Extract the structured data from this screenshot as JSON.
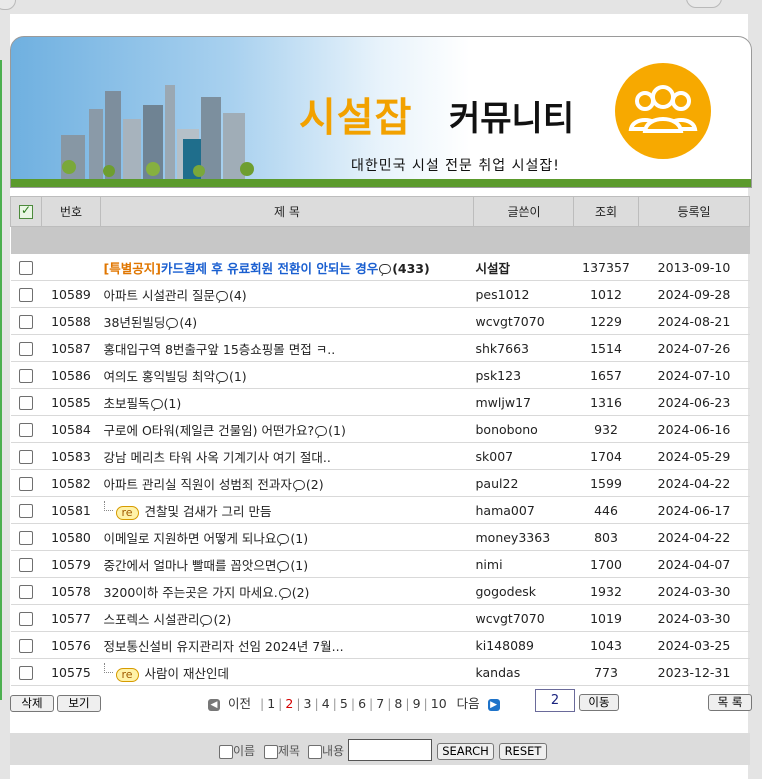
{
  "banner": {
    "title_orange": "시설잡",
    "title_dark": "커뮤니티",
    "subtitle": "대한민국 시설 전문 취업 시설잡!"
  },
  "table": {
    "headers": {
      "num": "번호",
      "subject": "제 목",
      "writer": "글쓴이",
      "views": "조회",
      "date": "등록일"
    },
    "notice": {
      "tag": "[특별공지]",
      "title": "카드결제 후 유료회원 전환이 안되는 경우",
      "comments": "(433)",
      "writer": "시설잡",
      "views": "137357",
      "date": "2013-09-10"
    },
    "rows": [
      {
        "num": "10589",
        "title": "아파트 시설관리 질문",
        "comments": "(4)",
        "writer": "pes1012",
        "views": "1012",
        "date": "2024-09-28",
        "reply": false
      },
      {
        "num": "10588",
        "title": "38년된빌딩",
        "comments": "(4)",
        "writer": "wcvgt7070",
        "views": "1229",
        "date": "2024-08-21",
        "reply": false
      },
      {
        "num": "10587",
        "title": "홍대입구역 8번출구앞 15층쇼핑몰 면접 ㅋ..",
        "comments": "",
        "writer": "shk7663",
        "views": "1514",
        "date": "2024-07-26",
        "reply": false
      },
      {
        "num": "10586",
        "title": "여의도 홍익빌딩 최악",
        "comments": "(1)",
        "writer": "psk123",
        "views": "1657",
        "date": "2024-07-10",
        "reply": false
      },
      {
        "num": "10585",
        "title": "초보필독",
        "comments": "(1)",
        "writer": "mwljw17",
        "views": "1316",
        "date": "2024-06-23",
        "reply": false
      },
      {
        "num": "10584",
        "title": "구로에 O타워(제일큰 건물임) 어떤가요?",
        "comments": "(1)",
        "writer": "bonobono",
        "views": "932",
        "date": "2024-06-16",
        "reply": false
      },
      {
        "num": "10583",
        "title": "강남 메리츠 타워 사옥 기계기사 여기 절대..",
        "comments": "",
        "writer": "sk007",
        "views": "1704",
        "date": "2024-05-29",
        "reply": false
      },
      {
        "num": "10582",
        "title": "아파트 관리실 직원이 성범죄 전과자",
        "comments": "(2)",
        "writer": "paul22",
        "views": "1599",
        "date": "2024-04-22",
        "reply": false
      },
      {
        "num": "10581",
        "title": "견찰및 검새가 그리 만듬",
        "comments": "",
        "writer": "hama007",
        "views": "446",
        "date": "2024-06-17",
        "reply": true
      },
      {
        "num": "10580",
        "title": "이메일로 지원하면 어떻게 되나요",
        "comments": "(1)",
        "writer": "money3363",
        "views": "803",
        "date": "2024-04-22",
        "reply": false
      },
      {
        "num": "10579",
        "title": "중간에서 얼마나 빨때를 꼽앗으면",
        "comments": "(1)",
        "writer": "nimi",
        "views": "1700",
        "date": "2024-04-07",
        "reply": false
      },
      {
        "num": "10578",
        "title": "3200이하 주는곳은 가지 마세요.",
        "comments": "(2)",
        "writer": "gogodesk",
        "views": "1932",
        "date": "2024-03-30",
        "reply": false
      },
      {
        "num": "10577",
        "title": "스포렉스 시설관리",
        "comments": "(2)",
        "writer": "wcvgt7070",
        "views": "1019",
        "date": "2024-03-30",
        "reply": false
      },
      {
        "num": "10576",
        "title": "정보통신설비 유지관리자 선임 2024년 7월...",
        "comments": "",
        "writer": "ki148089",
        "views": "1043",
        "date": "2024-03-25",
        "reply": false
      },
      {
        "num": "10575",
        "title": "사람이 재산인데",
        "comments": "",
        "writer": "kandas",
        "views": "773",
        "date": "2023-12-31",
        "reply": true
      }
    ],
    "re_label": "re"
  },
  "actions": {
    "delete": "삭제",
    "view": "보기",
    "list": "목 록",
    "move": "이동"
  },
  "pager": {
    "prev": "이전",
    "next": "다음",
    "pages": [
      "1",
      "2",
      "3",
      "4",
      "5",
      "6",
      "7",
      "8",
      "9",
      "10"
    ],
    "current": "2",
    "input_value": "2"
  },
  "search": {
    "opt_name": "이름",
    "opt_title": "제목",
    "opt_content": "내용",
    "search_btn": "SEARCH",
    "reset_btn": "RESET",
    "query": ""
  },
  "colors": {
    "accent_orange": "#f2a100",
    "views_red": "#d40000",
    "notice_blue": "#1a5fd0",
    "grass": "#5b9a2c"
  }
}
